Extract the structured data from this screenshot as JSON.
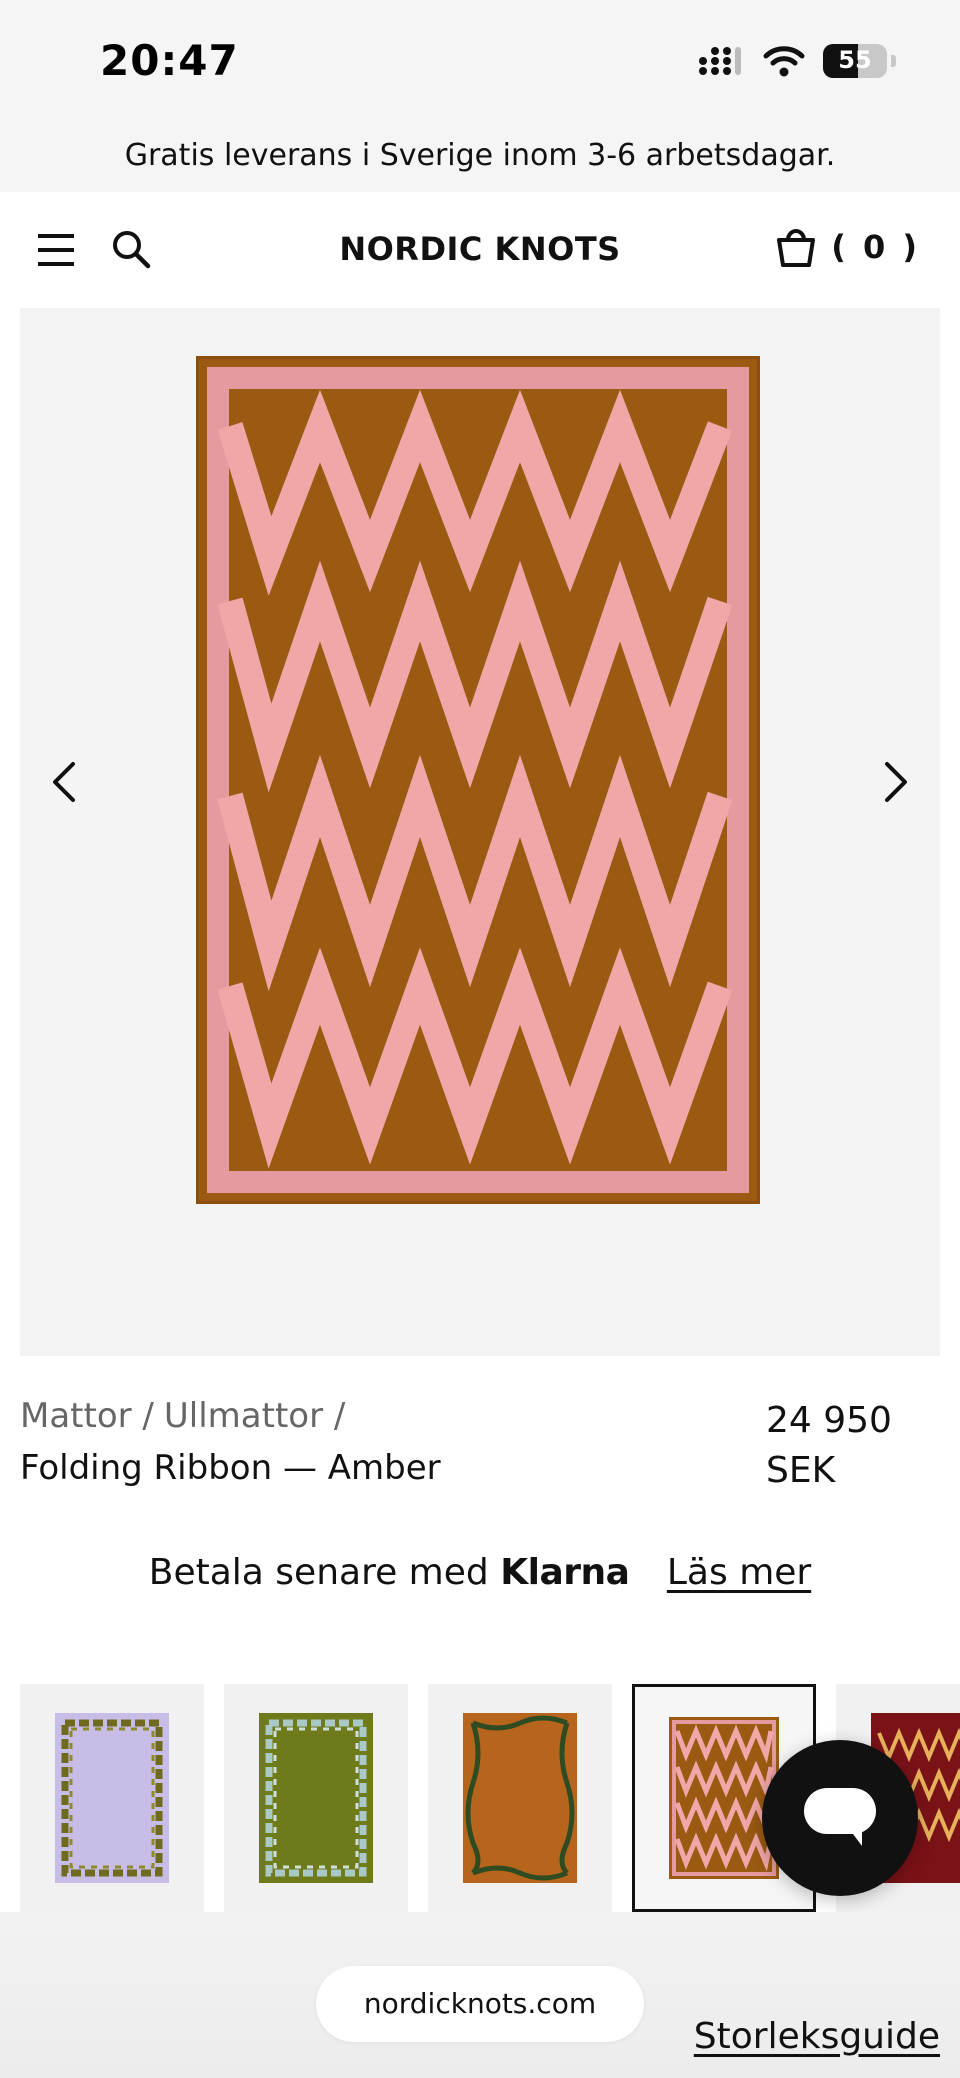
{
  "status_bar": {
    "time": "20:47",
    "battery": "55",
    "battery_level": 0.55
  },
  "promo": {
    "text": "Gratis leverans i Sverige inom 3-6 arbetsdagar."
  },
  "header": {
    "brand": "NORDIC KNOTS",
    "cart_count": "( 0 )"
  },
  "product": {
    "breadcrumb": [
      "Mattor /",
      "Ullmattor /"
    ],
    "title": "Folding Ribbon — Amber",
    "price_amount": "24 950",
    "price_currency": "SEK",
    "image_colors": {
      "field": "#9a5a12",
      "ribbon": "#f0a8a8",
      "border": "#d88a92"
    }
  },
  "klarna": {
    "prefix": "Betala senare med",
    "brand": "Klarna",
    "link": "Läs mer"
  },
  "variants": [
    {
      "field": "#c8bde6",
      "pattern": "braid-olive",
      "selected": false
    },
    {
      "field": "#6f7a1a",
      "pattern": "braid-blue",
      "selected": false
    },
    {
      "field": "#b7651c",
      "pattern": "wave-green",
      "selected": false
    },
    {
      "field": "#9a5a12",
      "pattern": "zigzag-pink",
      "selected": true
    },
    {
      "field": "#7a1218",
      "pattern": "zigzag-gold",
      "selected": false
    }
  ],
  "footer": {
    "url": "nordicknots.com",
    "size_guide": "Storleksguide"
  },
  "icons": [
    "signal-icon",
    "wifi-icon",
    "battery-icon",
    "menu-icon",
    "search-icon",
    "bag-icon",
    "chevron-left-icon",
    "chevron-right-icon",
    "chat-icon"
  ],
  "colors": {
    "background": "#ffffff",
    "banner": "#f5f5f5",
    "gallery": "#f4f4f4",
    "text": "#111111",
    "muted": "#666666"
  }
}
